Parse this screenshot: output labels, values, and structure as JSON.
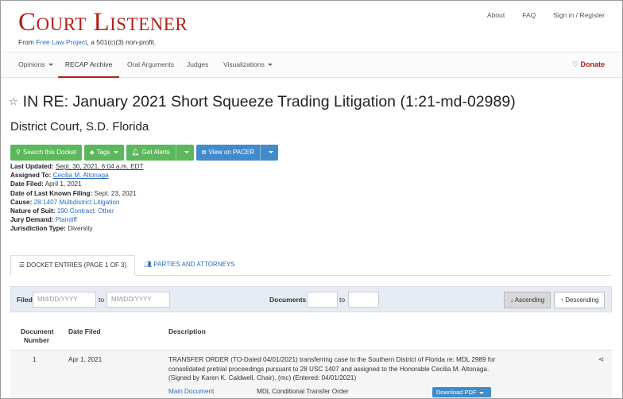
{
  "header": {
    "logo": "Court Listener",
    "tagline_prefix": "From ",
    "tagline_link": "Free Law Project",
    "tagline_suffix": ", a 501(c)(3) non-profit.",
    "links": [
      "About",
      "FAQ",
      "Sign in / Register"
    ]
  },
  "nav": {
    "items": [
      {
        "label": "Opinions",
        "dropdown": true,
        "active": false
      },
      {
        "label": "RECAP Archive",
        "dropdown": false,
        "active": true
      },
      {
        "label": "Oral Arguments",
        "dropdown": false,
        "active": false
      },
      {
        "label": "Judges",
        "dropdown": false,
        "active": false
      },
      {
        "label": "Visualizations",
        "dropdown": true,
        "active": false
      }
    ],
    "donate": "Donate"
  },
  "case": {
    "title": "IN RE: January 2021 Short Squeeze Trading Litigation (1:21-md-02989)",
    "court": "District Court, S.D. Florida"
  },
  "actions": {
    "search_docket": "Search this Docket",
    "tags": "Tags",
    "get_alerts": "Get Alerts",
    "view_pacer": "View on PACER"
  },
  "meta": {
    "last_updated_label": "Last Updated:",
    "last_updated": "Sept. 30, 2021, 6:04 a.m. EDT",
    "assigned_label": "Assigned To:",
    "assigned": "Cecilia M. Altonaga",
    "date_filed_label": "Date Filed:",
    "date_filed": "April 1, 2021",
    "last_filing_label": "Date of Last Known Filing:",
    "last_filing": "Sept. 23, 2021",
    "cause_label": "Cause:",
    "cause": "28:1407 Multidistrict Litigation",
    "nature_label": "Nature of Suit:",
    "nature": "190 Contract: Other",
    "jury_label": "Jury Demand:",
    "jury": "Plaintiff",
    "jurisdiction_label": "Jurisdiction Type:",
    "jurisdiction": "Diversity"
  },
  "tabs": {
    "docket": "DOCKET ENTRIES (PAGE 1 OF 3)",
    "parties": "PARTIES AND ATTORNEYS"
  },
  "filter": {
    "filed_label": "Filed",
    "to": "to",
    "date_placeholder": "MM/DD/YYYY",
    "documents_label": "Documents",
    "ascending": "Ascending",
    "descending": "Descending"
  },
  "table": {
    "headers": {
      "document_number": "Document Number",
      "date_filed": "Date Filed",
      "description": "Description"
    },
    "rows": [
      {
        "number": "1",
        "date": "Apr 1, 2021",
        "description": "TRANSFER ORDER (TO-Dated 04/01/2021) transferring case to the Southern District of Florida re: MDL 2989 for consolidated pretrial proceedings pursuant to 28 USC 1407 and assigned to the Honorable Cecilia M. Altonaga. (Signed by Karen K. Caldwell, Chair). (mc) (Entered: 04/01/2021)",
        "main_doc": "Main Document",
        "doc_desc": "MDL Conditional Transfer Order",
        "download": "Download PDF"
      }
    ]
  },
  "colors": {
    "brand_red": "#b2211a",
    "green": "#5cb85c",
    "blue": "#428bca",
    "link": "#2a6bbf"
  }
}
